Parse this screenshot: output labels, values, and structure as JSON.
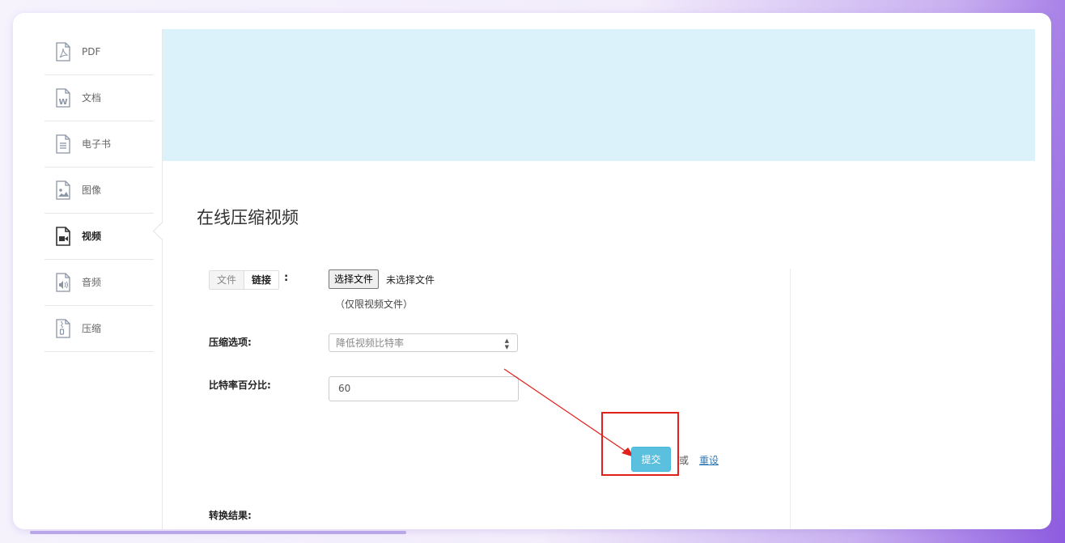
{
  "sidebar": {
    "items": [
      {
        "label": "PDF",
        "icon": "pdf-file-icon"
      },
      {
        "label": "文档",
        "icon": "word-file-icon"
      },
      {
        "label": "电子书",
        "icon": "ebook-file-icon"
      },
      {
        "label": "图像",
        "icon": "image-file-icon"
      },
      {
        "label": "视频",
        "icon": "video-file-icon",
        "active": true
      },
      {
        "label": "音频",
        "icon": "audio-file-icon"
      },
      {
        "label": "压缩",
        "icon": "archive-file-icon"
      }
    ]
  },
  "page": {
    "title": "在线压缩视频"
  },
  "form": {
    "source_tabs": [
      "文件",
      "链接"
    ],
    "source_colon": ":",
    "file_button": "选择文件",
    "file_status": "未选择文件",
    "file_hint": "（仅限视频文件）",
    "compress_option_label": "压缩选项:",
    "compress_option_value": "降低视频比特率",
    "bitrate_label": "比特率百分比:",
    "bitrate_value": "60",
    "submit_label": "提交",
    "or_text": "或",
    "reset_label": "重设",
    "result_label": "转换结果:"
  },
  "colors": {
    "banner": "#dcf2fa",
    "submit": "#5bc0de",
    "annotation": "#e4201c"
  }
}
